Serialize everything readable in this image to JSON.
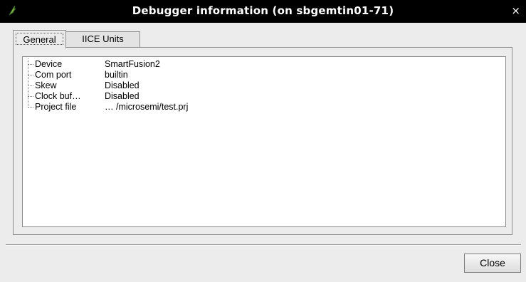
{
  "window": {
    "title": "Debugger information (on sbgemtin01-71)",
    "close_glyph": "×",
    "app_icon": "tcl-feather-icon"
  },
  "tabs": [
    {
      "label": "General",
      "selected": true
    },
    {
      "label": "IICE Units",
      "selected": false
    }
  ],
  "info": [
    {
      "key": "Device",
      "value": "SmartFusion2"
    },
    {
      "key": "Com port",
      "value": "builtin"
    },
    {
      "key": "Skew",
      "value": "Disabled"
    },
    {
      "key": "Clock buf…",
      "value": "Disabled"
    },
    {
      "key": "Project file",
      "value": "… /microsemi/test.prj"
    }
  ],
  "buttons": {
    "close_label": "Close"
  },
  "colors": {
    "titlebar_bg": "#000000",
    "dialog_bg": "#ececec",
    "tree_bg": "#ffffff"
  }
}
